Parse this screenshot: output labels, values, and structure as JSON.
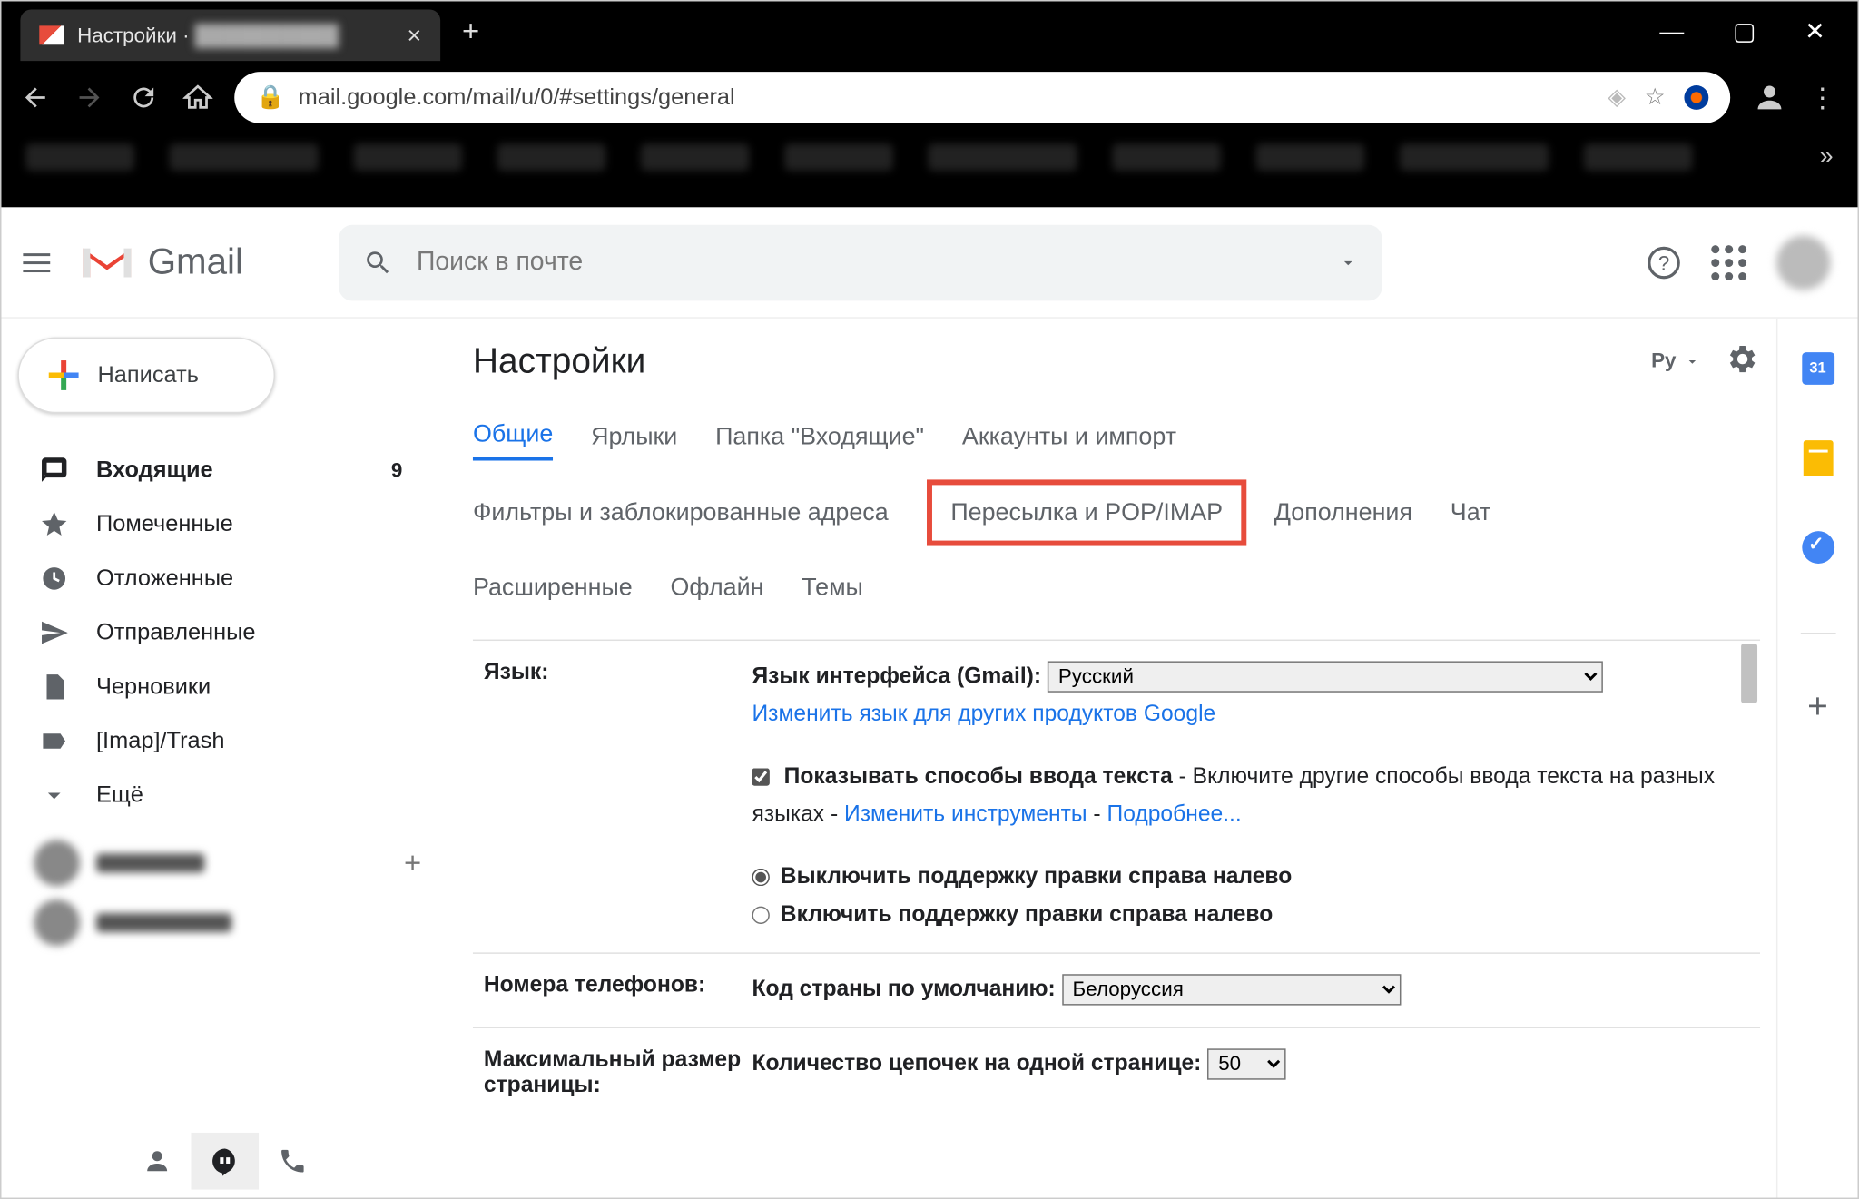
{
  "browser": {
    "tab_title": "Настройки ·",
    "url": "mail.google.com/mail/u/0/#settings/general"
  },
  "app": {
    "name": "Gmail",
    "search_placeholder": "Поиск в почте",
    "compose": "Написать",
    "calendar_day": "31"
  },
  "sidebar": {
    "inbox": "Входящие",
    "inbox_count": "9",
    "starred": "Помеченные",
    "snoozed": "Отложенные",
    "sent": "Отправленные",
    "drafts": "Черновики",
    "imap_trash": "[Imap]/Trash",
    "more": "Ещё"
  },
  "settings": {
    "title": "Настройки",
    "input_indicator": "Ру",
    "tabs": {
      "general": "Общие",
      "labels": "Ярлыки",
      "inbox": "Папка \"Входящие\"",
      "accounts": "Аккаунты и импорт",
      "filters": "Фильтры и заблокированные адреса",
      "forwarding": "Пересылка и POP/IMAP",
      "addons": "Дополнения",
      "chat": "Чат",
      "advanced": "Расширенные",
      "offline": "Офлайн",
      "themes": "Темы"
    },
    "language": {
      "label": "Язык:",
      "ui_label": "Язык интерфейса (Gmail):",
      "selected": "Русский",
      "change_link": "Изменить язык для других продуктов Google",
      "show_input_tools": "Показывать способы ввода текста",
      "input_tools_desc": " - Включите другие способы ввода текста на разных языках - ",
      "tools_link": "Изменить инструменты",
      "more_link": "Подробнее...",
      "rtl_off": "Выключить поддержку правки справа налево",
      "rtl_on": "Включить поддержку правки справа налево"
    },
    "phone": {
      "label": "Номера телефонов:",
      "country_label": "Код страны по умолчанию:",
      "country_selected": "Белоруссия"
    },
    "page_size": {
      "label": "Максимальный размер страницы:",
      "threads_label": "Количество цепочек на одной странице:",
      "value": "50"
    }
  }
}
